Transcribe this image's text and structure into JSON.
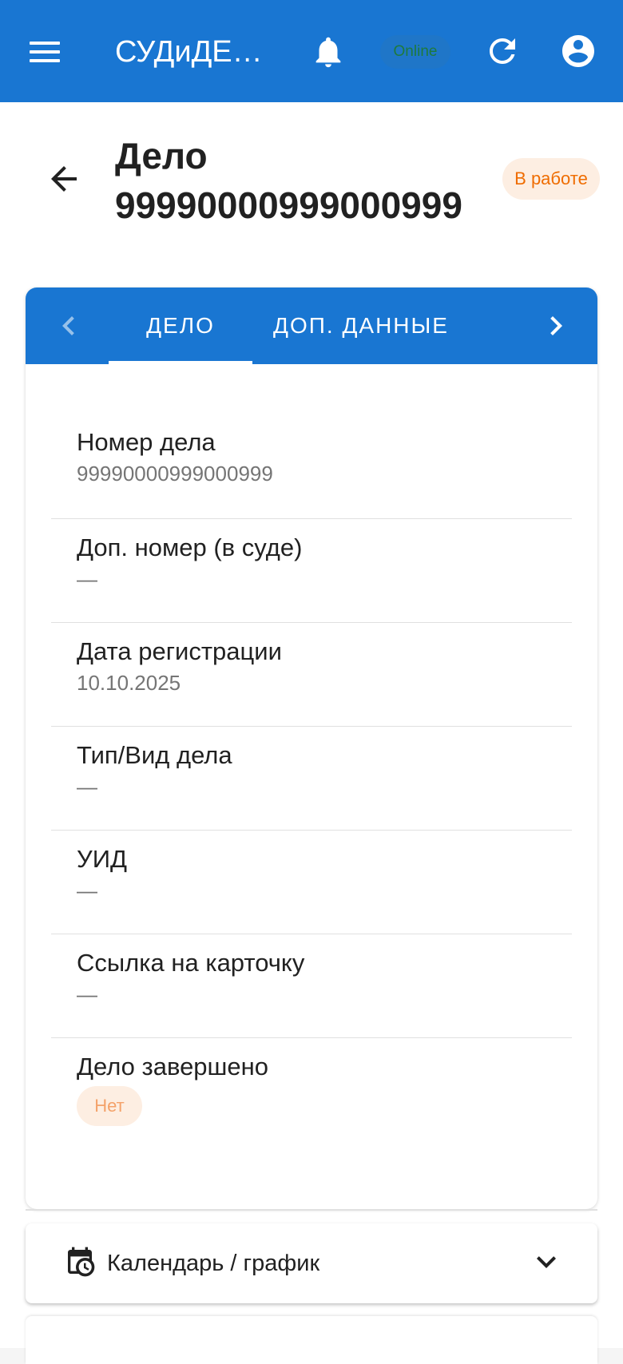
{
  "appbar": {
    "title": "СУДиДЕ…",
    "connection_status": "Online",
    "icons": [
      "menu-icon",
      "bell-icon",
      "refresh-icon",
      "account-circle-icon"
    ]
  },
  "case": {
    "title_prefix": "Дело",
    "number": "99990000999000999",
    "status": "В работе"
  },
  "tabs": {
    "items": [
      {
        "label": "ДЕЛО",
        "active": true
      },
      {
        "label": "ДОП. ДАННЫЕ",
        "active": false
      }
    ]
  },
  "fields": [
    {
      "label": "Номер дела",
      "value": "99990000999000999"
    },
    {
      "label": "Доп. номер (в суде)",
      "value": "—"
    },
    {
      "label": "Дата регистрации",
      "value": "10.10.2025"
    },
    {
      "label": "Тип/Вид дела",
      "value": "—"
    },
    {
      "label": "УИД",
      "value": "—"
    },
    {
      "label": "Ссылка на карточку",
      "value": "—"
    },
    {
      "label": "Дело завершено",
      "value": "Нет"
    }
  ],
  "accordion": {
    "calendar_label": "Календарь / график"
  },
  "colors": {
    "primary": "#1976d2",
    "status_bg": "#fdeee2",
    "status_text": "#ef6c00",
    "online_text": "#1e7a3d"
  }
}
